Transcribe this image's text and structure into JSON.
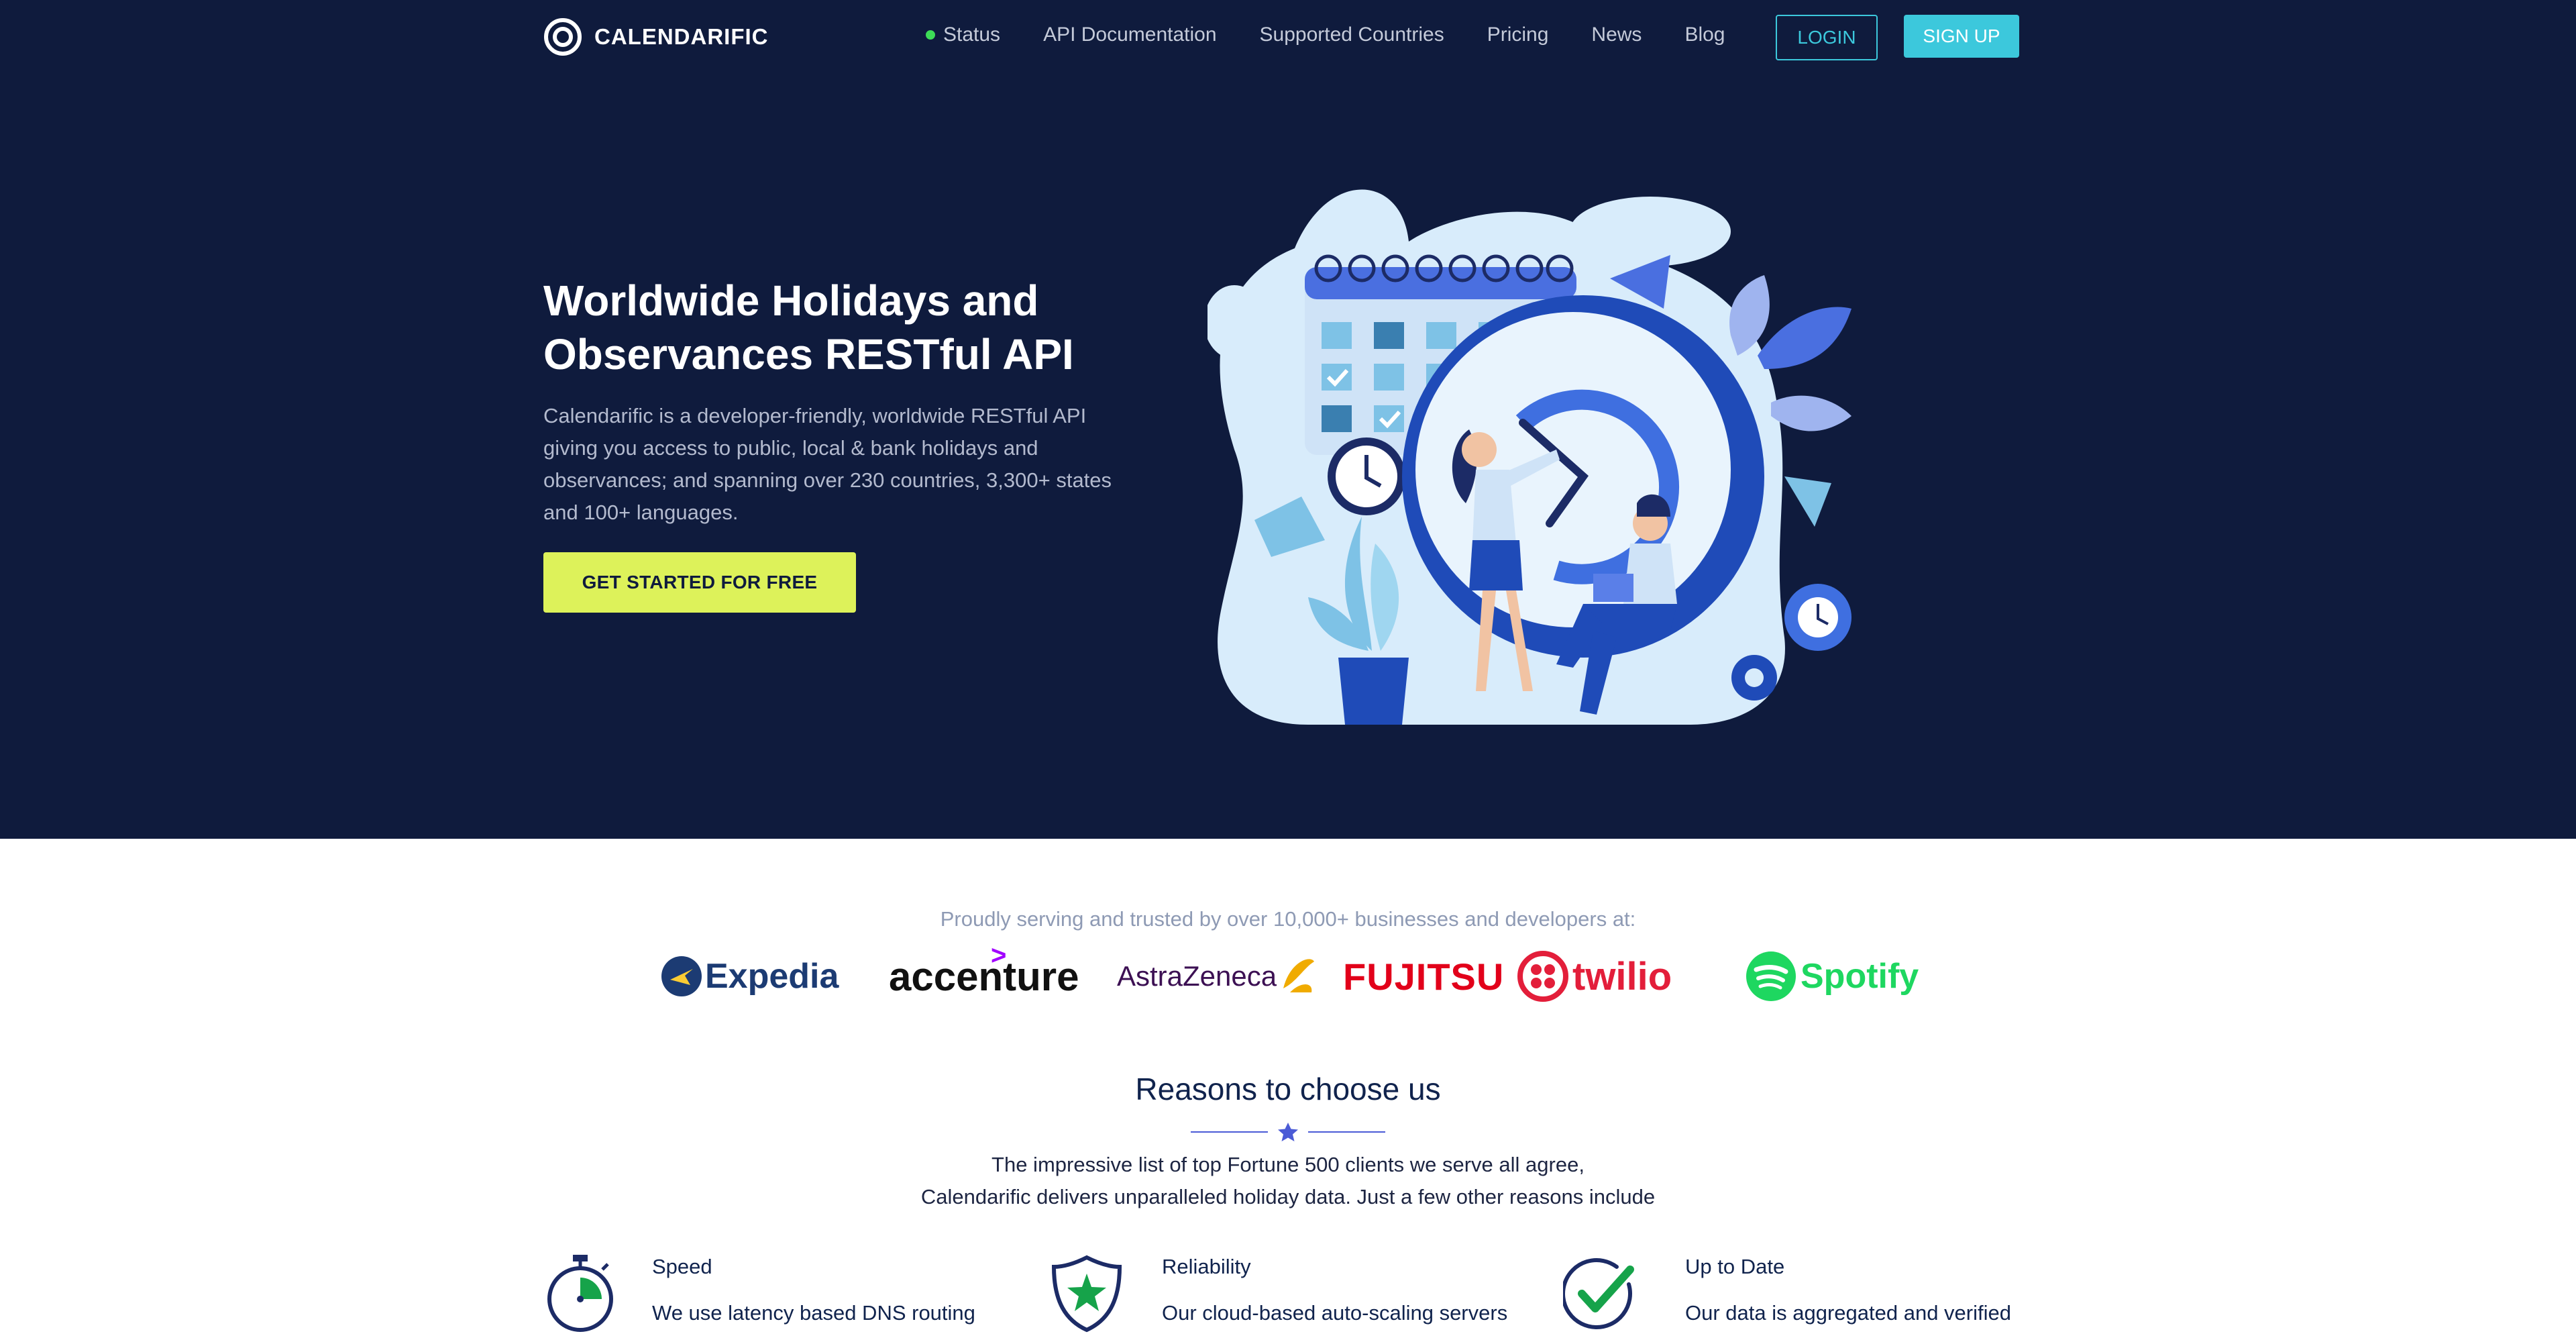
{
  "brand": {
    "name": "CALENDARIFIC"
  },
  "nav": {
    "status": "Status",
    "items": [
      "API Documentation",
      "Supported Countries",
      "Pricing",
      "News",
      "Blog"
    ],
    "login": "LOGIN",
    "signup": "SIGN UP"
  },
  "hero": {
    "title_line1": "Worldwide Holidays and",
    "title_line2": "Observances RESTful API",
    "desc_lines": [
      "Calendarific is a developer-friendly, worldwide RESTful API",
      "giving you access to public, local & bank holidays and",
      "observances; and spanning over 230 countries, 3,300+ states",
      "and 100+ languages."
    ],
    "cta": "GET STARTED FOR FREE"
  },
  "trusted": {
    "text": "Proudly serving and trusted by over 10,000+ businesses and developers at:",
    "logos": [
      "Expedia",
      "accenture",
      "AstraZeneca",
      "FUJITSU",
      "twilio",
      "Spotify"
    ]
  },
  "reasons": {
    "title": "Reasons to choose us",
    "sub_line1": "The impressive list of top Fortune 500 clients we serve all agree,",
    "sub_line2": "Calendarific delivers unparalleled holiday data. Just a few other reasons include",
    "features": [
      {
        "title": "Speed",
        "text": "We use latency based DNS routing",
        "icon": "stopwatch-icon"
      },
      {
        "title": "Reliability",
        "text": "Our cloud-based auto-scaling servers",
        "icon": "shield-star-icon"
      },
      {
        "title": "Up to Date",
        "text": "Our data is aggregated and verified",
        "icon": "checkmark-icon"
      }
    ]
  },
  "colors": {
    "hero_bg": "#0f1b3d",
    "accent_cyan": "#3cc8dc",
    "cta_lime": "#ddf25a",
    "status_green": "#3ddc57",
    "divider_blue": "#4b5bd6"
  }
}
